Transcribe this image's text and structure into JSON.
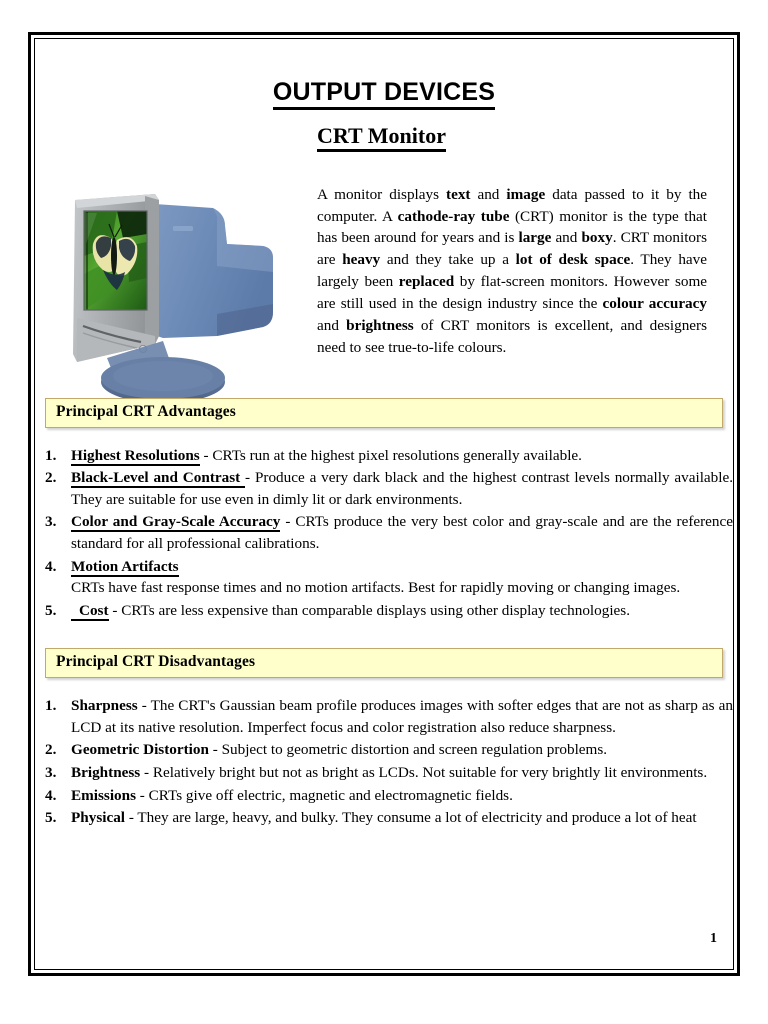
{
  "document": {
    "title": "OUTPUT DEVICES",
    "subtitle": "CRT Monitor",
    "page_number": "1"
  },
  "intro": {
    "paragraph_runs": [
      {
        "t": "A monitor displays ",
        "b": false
      },
      {
        "t": "text",
        "b": true
      },
      {
        "t": " and ",
        "b": false
      },
      {
        "t": "image",
        "b": true
      },
      {
        "t": " data passed to it by the computer.  A ",
        "b": false
      },
      {
        "t": "cathode-ray tube",
        "b": true
      },
      {
        "t": " (CRT) monitor is the type that has been around for years and is ",
        "b": false
      },
      {
        "t": "large",
        "b": true
      },
      {
        "t": " and ",
        "b": false
      },
      {
        "t": "boxy",
        "b": true
      },
      {
        "t": ".  CRT monitors are ",
        "b": false
      },
      {
        "t": "heavy",
        "b": true
      },
      {
        "t": " and they take up a ",
        "b": false
      },
      {
        "t": "lot of desk space",
        "b": true
      },
      {
        "t": ". They have largely been ",
        "b": false
      },
      {
        "t": "replaced",
        "b": true
      },
      {
        "t": " by flat-screen monitors. However some are still used in the design industry since the ",
        "b": false
      },
      {
        "t": "colour accuracy",
        "b": true
      },
      {
        "t": " and ",
        "b": false
      },
      {
        "t": "brightness",
        "b": true
      },
      {
        "t": " of CRT monitors is excellent, and designers need to see true-to-life colours.",
        "b": false
      }
    ],
    "image": {
      "name": "crt-monitor-photo",
      "screen_subject": "butterfly on green leaves",
      "bezel_color": "#a9adaf",
      "body_color": "#6e8cb8",
      "base_color": "#5a7196"
    }
  },
  "advantages": {
    "banner_label": "Principal CRT Advantages",
    "items": [
      {
        "number": "1.",
        "lead": "Highest Resolutions",
        "lead_style": "bold-underline",
        "dash": " - ",
        "body": "CRTs run at the highest pixel resolutions generally available.",
        "body_on_new_line": false,
        "extra_indent": false
      },
      {
        "number": "2.",
        "lead": "Black-Level and Contrast ",
        "lead_style": "bold-underline",
        "dash": " - ",
        "body": "Produce a very dark black and the highest contrast levels normally available. They are suitable for use even in dimly lit or dark environments.",
        "body_on_new_line": false,
        "extra_indent": false
      },
      {
        "number": "3.",
        "lead": "Color and Gray-Scale Accuracy",
        "lead_style": "bold-underline",
        "dash": " - ",
        "body": "CRTs produce the very best color and gray-scale and are the reference standard for all professional calibrations.",
        "body_on_new_line": false,
        "extra_indent": false
      },
      {
        "number": "4.",
        "lead": "Motion Artifacts",
        "lead_style": "bold-underline",
        "dash": "",
        "body": "CRTs have fast response times and no motion artifacts. Best for rapidly moving or changing images.",
        "body_on_new_line": true,
        "extra_indent": false
      },
      {
        "number": "5.",
        "lead": "Cost",
        "lead_style": "bold-underline",
        "dash": " - ",
        "body": "CRTs are less expensive than comparable displays using other display technologies.",
        "body_on_new_line": false,
        "extra_indent": true
      }
    ]
  },
  "disadvantages": {
    "banner_label": "Principal CRT Disadvantages",
    "items": [
      {
        "number": "1.",
        "lead": "Sharpness",
        "lead_style": "bold",
        "dash": " - ",
        "body": "The CRT's Gaussian beam profile produces images with softer edges that are not as sharp as an LCD at its native resolution. Imperfect focus and color registration also reduce sharpness.",
        "body_on_new_line": false,
        "extra_indent": false
      },
      {
        "number": "2.",
        "lead": "Geometric Distortion",
        "lead_style": "bold",
        "dash": " - ",
        "body": "Subject to geometric distortion and screen regulation problems.",
        "body_on_new_line": false,
        "extra_indent": false
      },
      {
        "number": "3.",
        "lead": "Brightness",
        "lead_style": "bold",
        "dash": " - ",
        "body": "Relatively bright but not as bright as LCDs. Not suitable for very brightly lit environments.",
        "body_on_new_line": false,
        "extra_indent": false
      },
      {
        "number": "4.",
        "lead": "Emissions",
        "lead_style": "bold",
        "dash": " - ",
        "body": "CRTs give off electric, magnetic and electromagnetic fields.",
        "body_on_new_line": false,
        "extra_indent": false
      },
      {
        "number": "5.",
        "lead": "Physical",
        "lead_style": "bold",
        "dash": " - ",
        "body": "They are large, heavy, and bulky. They consume a lot of electricity and produce a lot of heat",
        "body_on_new_line": false,
        "extra_indent": false
      }
    ]
  },
  "theme": {
    "banner_background": "#ffffcc",
    "banner_border": "#c2a96a",
    "text_color": "#000000",
    "page_background": "#ffffff"
  }
}
